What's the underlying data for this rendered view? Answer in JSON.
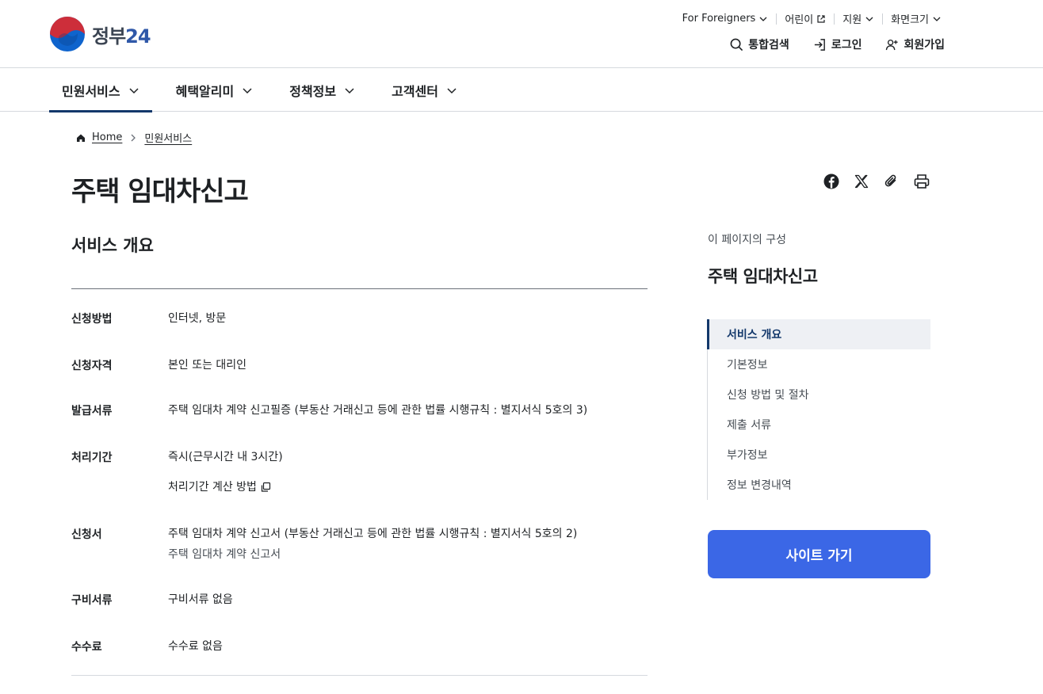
{
  "header": {
    "logo_text": "정부",
    "logo_num": "24",
    "util": [
      {
        "label": "For Foreigners",
        "icon": "chevron-down-icon"
      },
      {
        "label": "어린이",
        "icon": "external-link-icon"
      },
      {
        "label": "지원",
        "icon": "chevron-down-icon"
      },
      {
        "label": "화면크기",
        "icon": "chevron-down-icon"
      }
    ],
    "actions": {
      "search": "통합검색",
      "login": "로그인",
      "signup": "회원가입"
    }
  },
  "gnb": [
    {
      "label": "민원서비스",
      "active": true
    },
    {
      "label": "혜택알리미",
      "active": false
    },
    {
      "label": "정책정보",
      "active": false
    },
    {
      "label": "고객센터",
      "active": false
    }
  ],
  "breadcrumb": {
    "home": "Home",
    "current": "민원서비스"
  },
  "page_title": "주택 임대차신고",
  "section_title": "서비스 개요",
  "info": {
    "method": {
      "label": "신청방법",
      "value": "인터넷, 방문"
    },
    "eligibility": {
      "label": "신청자격",
      "value": "본인 또는 대리인"
    },
    "issued_doc": {
      "label": "발급서류",
      "value": "주택 임대차 계약 신고필증 (부동산 거래신고 등에 관한 법률 시행규칙 : 별지서식 5호의 3)"
    },
    "period": {
      "label": "처리기간",
      "value": "즉시(근무시간 내 3시간)",
      "link": "처리기간 계산 방법"
    },
    "form": {
      "label": "신청서",
      "value": "주택 임대차 계약 신고서 (부동산 거래신고 등에 관한 법률 시행규칙 : 별지서식 5호의 2)",
      "sub": "주택 임대차 계약 신고서"
    },
    "required": {
      "label": "구비서류",
      "value": "구비서류 없음"
    },
    "fee": {
      "label": "수수료",
      "value": "수수료 없음"
    }
  },
  "side": {
    "caption": "이 페이지의 구성",
    "title": "주택 임대차신고",
    "items": [
      "서비스 개요",
      "기본정보",
      "신청 방법 및 절차",
      "제출 서류",
      "부가정보",
      "정보 변경내역"
    ],
    "active_index": 0,
    "button": "사이트 가기"
  },
  "colors": {
    "primary": "#13386b",
    "button": "#3b67e6",
    "logo_red": "#cd2e3a",
    "logo_blue": "#0f64cd"
  }
}
